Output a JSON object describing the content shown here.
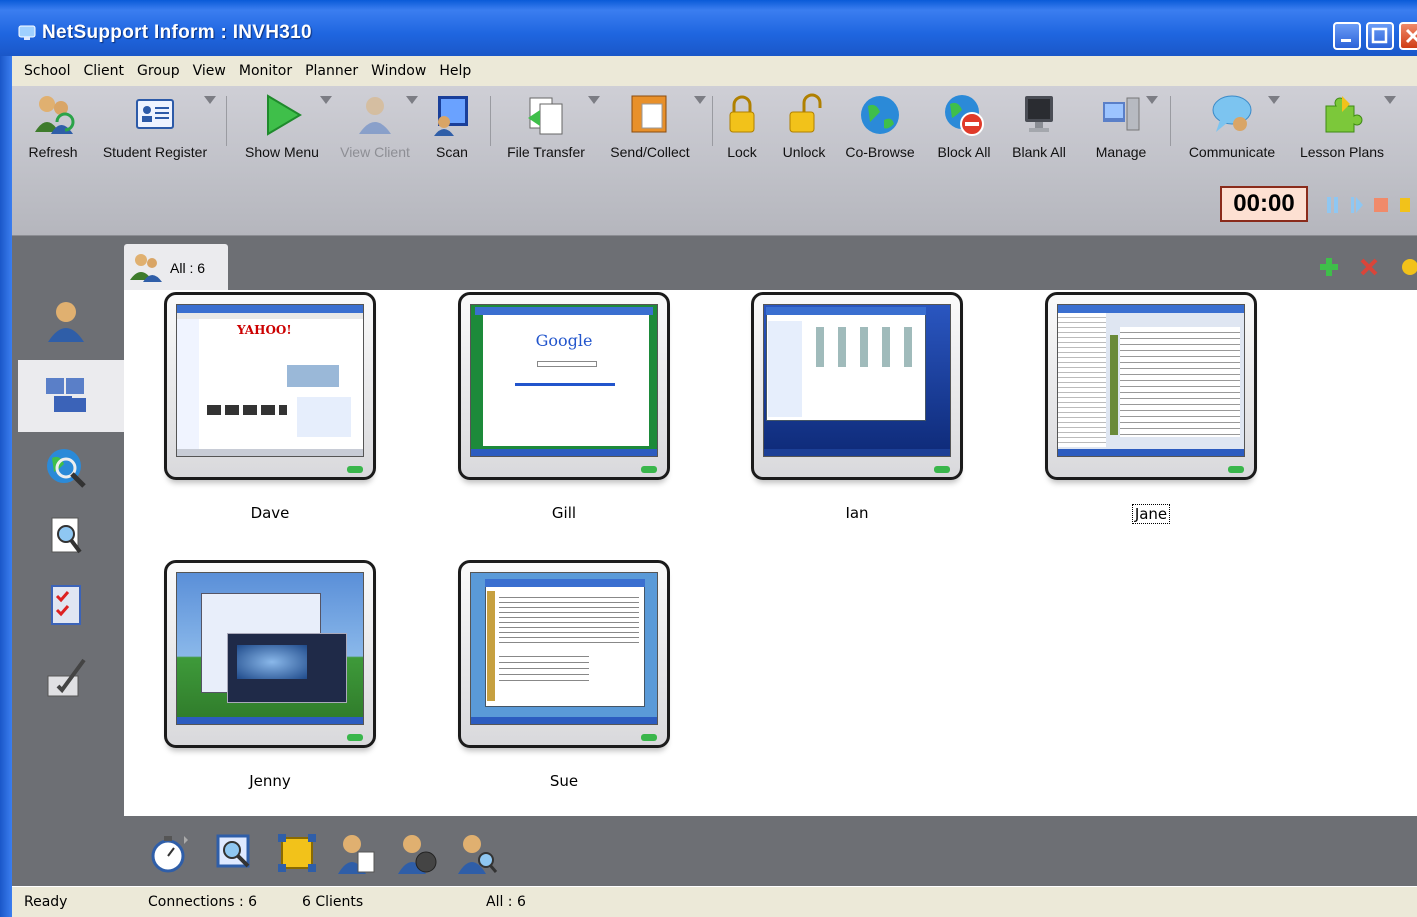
{
  "window": {
    "title": "NetSupport Inform : INVH310"
  },
  "menu": [
    "School",
    "Client",
    "Group",
    "View",
    "Monitor",
    "Planner",
    "Window",
    "Help"
  ],
  "toolbar": {
    "buttons": [
      {
        "label": "Refresh",
        "icon": "refresh-icon"
      },
      {
        "label": "Student Register",
        "icon": "student-register-icon"
      },
      {
        "label": "Show Menu",
        "icon": "play-icon"
      },
      {
        "label": "View Client",
        "icon": "view-client-icon",
        "disabled": true
      },
      {
        "label": "Scan",
        "icon": "scan-icon"
      },
      {
        "label": "File Transfer",
        "icon": "file-transfer-icon"
      },
      {
        "label": "Send/Collect",
        "icon": "send-collect-icon"
      },
      {
        "label": "Lock",
        "icon": "lock-icon"
      },
      {
        "label": "Unlock",
        "icon": "unlock-icon"
      },
      {
        "label": "Co-Browse",
        "icon": "globe-icon"
      },
      {
        "label": "Block All",
        "icon": "block-all-icon"
      },
      {
        "label": "Blank All",
        "icon": "monitor-icon"
      },
      {
        "label": "Manage",
        "icon": "manage-icon"
      },
      {
        "label": "Communicate",
        "icon": "chat-icon"
      },
      {
        "label": "Lesson Plans",
        "icon": "puzzle-icon"
      }
    ],
    "timer": "00:00"
  },
  "group_tab": {
    "label": "All : 6"
  },
  "clients": [
    {
      "name": "Dave",
      "screen": "yahoo"
    },
    {
      "name": "Gill",
      "screen": "google"
    },
    {
      "name": "Ian",
      "screen": "explorer"
    },
    {
      "name": "Jane",
      "screen": "document",
      "focused": true
    },
    {
      "name": "Jenny",
      "screen": "desktop"
    },
    {
      "name": "Sue",
      "screen": "list"
    }
  ],
  "screen_texts": {
    "yahoo": "YAHOO!",
    "google": "Google"
  },
  "status": {
    "ready": "Ready",
    "connections": "Connections : 6",
    "clients": "6 Clients",
    "group": "All : 6"
  },
  "colors": {
    "accent": "#1f66e0",
    "timer_bg": "#fde0d2",
    "led": "#39b64b"
  }
}
